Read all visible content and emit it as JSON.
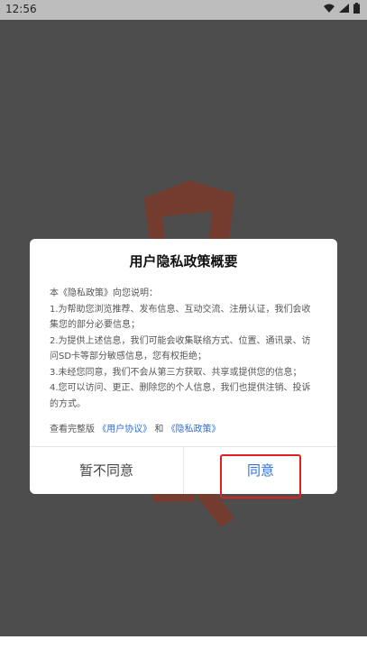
{
  "status_bar": {
    "time": "12:56",
    "icons": [
      "wifi-icon",
      "signal-icon",
      "battery-icon"
    ]
  },
  "dialog": {
    "title": "用户隐私政策概要",
    "body": [
      "本《隐私政策》向您说明：",
      "1.为帮助您浏览推荐、发布信息、互动交流、注册认证，我们会收集您的部分必要信息；",
      "2.为提供上述信息，我们可能会收集联络方式、位置、通讯录、访问SD卡等部分敏感信息，您有权拒绝；",
      "3.未经您同意，我们不会从第三方获取、共享或提供您的信息；",
      "4.您可以访问、更正、删除您的个人信息，我们也提供注销、投诉的方式。"
    ],
    "footer": {
      "prefix": "查看完整版",
      "user_agreement": "《用户协议》",
      "and": "和",
      "privacy_policy": "《隐私政策》"
    },
    "buttons": {
      "cancel": "暂不同意",
      "agree": "同意"
    }
  },
  "colors": {
    "accent": "#2f6fe0",
    "highlight": "#e02020",
    "overlay": "#4d4d4d"
  }
}
